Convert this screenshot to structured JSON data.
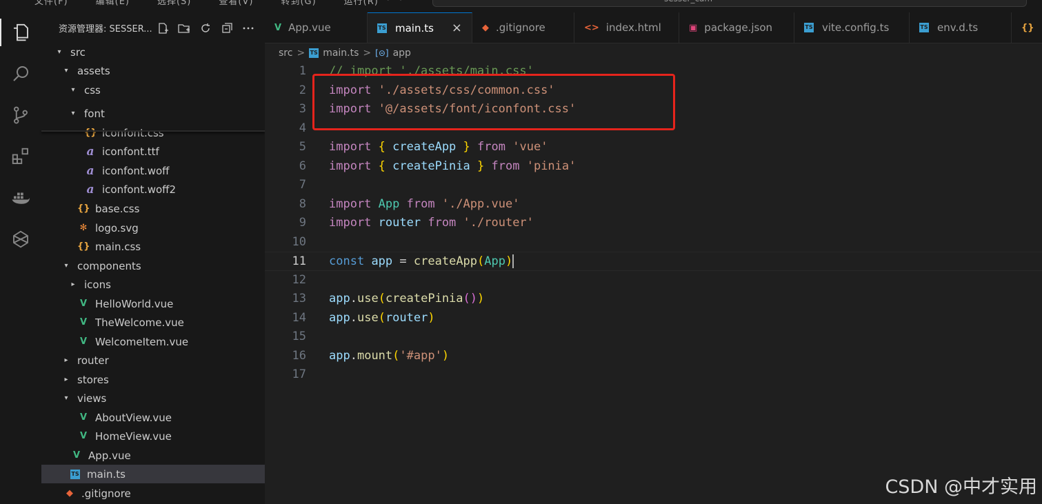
{
  "titlebar": {
    "menu": [
      "文件(F)",
      "编辑(E)",
      "选择(S)",
      "查看(V)",
      "转到(G)",
      "运行(R)"
    ],
    "nav": "←  →",
    "command_center": "sesser_cam"
  },
  "sidebar": {
    "title": "资源管理器: SESSER...",
    "tools": [
      "new-file-icon",
      "new-folder-icon",
      "refresh-icon",
      "collapse-icon",
      "more-icon"
    ],
    "items": [
      {
        "label": "src",
        "twisty": "▾",
        "icon": ""
      },
      {
        "label": "assets",
        "twisty": "▾",
        "icon": ""
      },
      {
        "label": "css",
        "twisty": "▾",
        "icon": ""
      },
      {
        "label": "font",
        "twisty": "▾",
        "icon": ""
      },
      {
        "label": "iconfont.css",
        "twisty": "",
        "icon": "{}"
      },
      {
        "label": "iconfont.ttf",
        "twisty": "",
        "icon": "a"
      },
      {
        "label": "iconfont.woff",
        "twisty": "",
        "icon": "a"
      },
      {
        "label": "iconfont.woff2",
        "twisty": "",
        "icon": "a"
      },
      {
        "label": "base.css",
        "twisty": "",
        "icon": "{}"
      },
      {
        "label": "logo.svg",
        "twisty": "",
        "icon": "✻"
      },
      {
        "label": "main.css",
        "twisty": "",
        "icon": "{}"
      },
      {
        "label": "components",
        "twisty": "▾",
        "icon": ""
      },
      {
        "label": "icons",
        "twisty": "▸",
        "icon": ""
      },
      {
        "label": "HelloWorld.vue",
        "twisty": "",
        "icon": "V"
      },
      {
        "label": "TheWelcome.vue",
        "twisty": "",
        "icon": "V"
      },
      {
        "label": "WelcomeItem.vue",
        "twisty": "",
        "icon": "V"
      },
      {
        "label": "router",
        "twisty": "▸",
        "icon": ""
      },
      {
        "label": "stores",
        "twisty": "▸",
        "icon": ""
      },
      {
        "label": "views",
        "twisty": "▾",
        "icon": ""
      },
      {
        "label": "AboutView.vue",
        "twisty": "",
        "icon": "V"
      },
      {
        "label": "HomeView.vue",
        "twisty": "",
        "icon": "V"
      },
      {
        "label": "App.vue",
        "twisty": "",
        "icon": "V"
      },
      {
        "label": "main.ts",
        "twisty": "",
        "icon": "TS"
      },
      {
        "label": ".gitignore",
        "twisty": "",
        "icon": "◆"
      }
    ]
  },
  "tabs": [
    {
      "label": "App.vue",
      "icon": "V"
    },
    {
      "label": "main.ts",
      "icon": "TS",
      "close": "×"
    },
    {
      "label": ".gitignore",
      "icon": "◆"
    },
    {
      "label": "index.html",
      "icon": "<>"
    },
    {
      "label": "package.json",
      "icon": "▣"
    },
    {
      "label": "vite.config.ts",
      "icon": "TS"
    },
    {
      "label": "env.d.ts",
      "icon": "TS"
    },
    {
      "label": "",
      "icon": "{}"
    }
  ],
  "breadcrumb": {
    "parts": [
      "src",
      "main.ts",
      "app"
    ],
    "sep": ">"
  },
  "editor": {
    "line_numbers": [
      "1",
      "2",
      "3",
      "4",
      "5",
      "6",
      "7",
      "8",
      "9",
      "10",
      "11",
      "12",
      "13",
      "14",
      "15",
      "16",
      "17"
    ],
    "lines": [
      "// import './assets/main.css'",
      "import './assets/css/common.css'",
      "import '@/assets/font/iconfont.css'",
      "",
      "import { createApp } from 'vue'",
      "import { createPinia } from 'pinia'",
      "",
      "import App from './App.vue'",
      "import router from './router'",
      "",
      "const app = createApp(App)",
      "",
      "app.use(createPinia())",
      "app.use(router)",
      "",
      "app.mount('#app')",
      ""
    ],
    "current_line": 11
  },
  "watermark": "CSDN @中才实用"
}
